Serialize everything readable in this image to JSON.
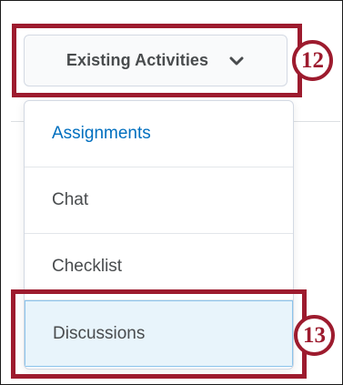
{
  "button": {
    "label": "Existing Activities",
    "icon": "chevron-down-icon"
  },
  "menu": {
    "items": [
      {
        "label": "Assignments",
        "style": "link"
      },
      {
        "label": "Chat",
        "style": "normal"
      },
      {
        "label": "Checklist",
        "style": "normal"
      },
      {
        "label": "Discussions",
        "style": "selected"
      }
    ]
  },
  "callouts": {
    "step_12": "12",
    "step_13": "13",
    "color": "#9d1b2e"
  },
  "colors": {
    "link": "#006fbf",
    "text": "#494c4e",
    "selected_bg": "#e8f4fb",
    "selected_border": "#8bc4ec"
  }
}
